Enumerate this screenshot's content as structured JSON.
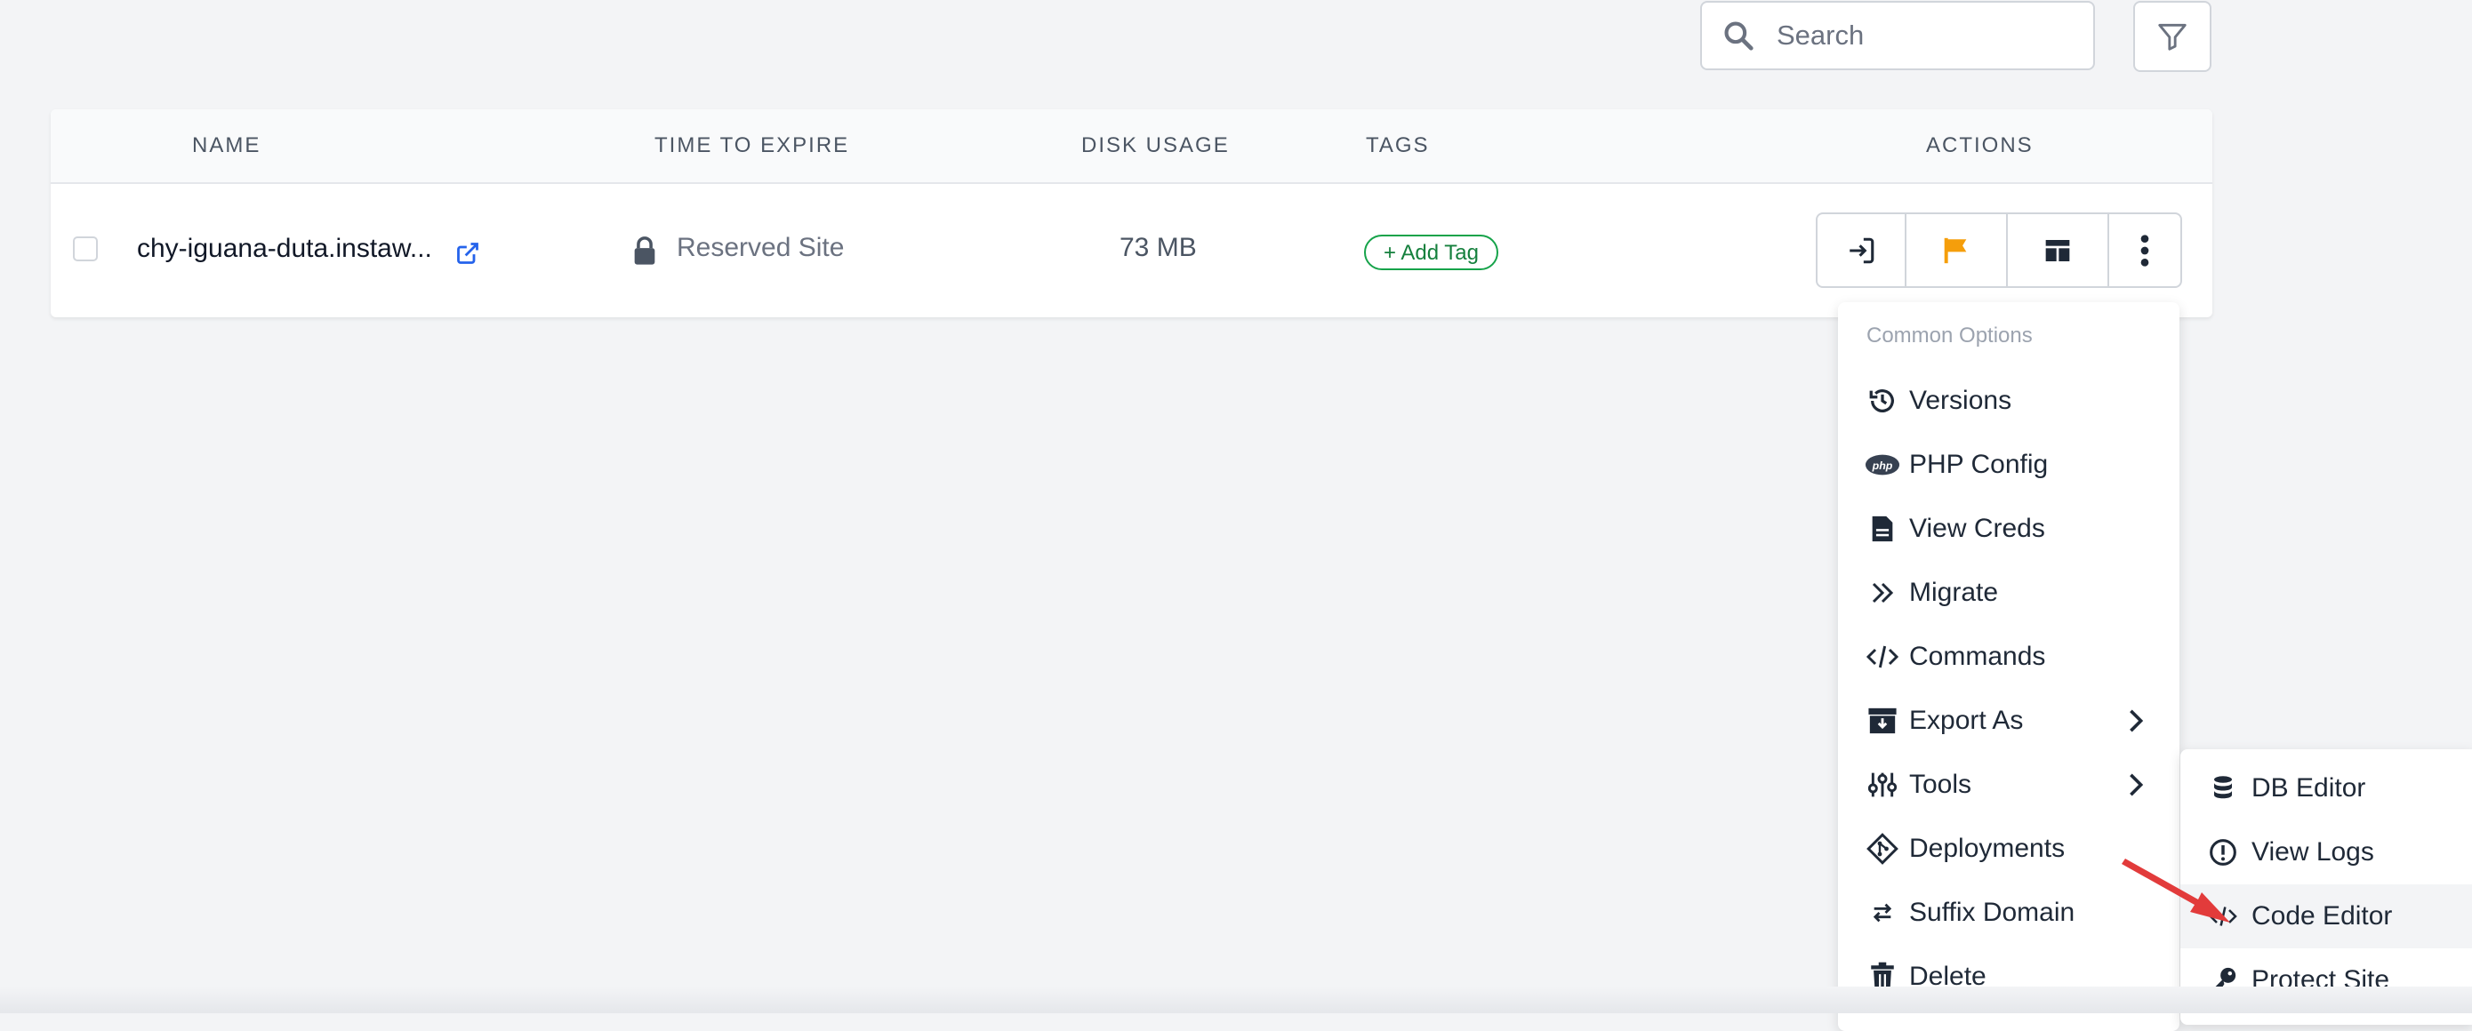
{
  "search": {
    "placeholder": "Search"
  },
  "table": {
    "columns": [
      "NAME",
      "TIME TO EXPIRE",
      "DISK USAGE",
      "TAGS",
      "ACTIONS"
    ],
    "rows": [
      {
        "name": "chy-iguana-duta.instaw...",
        "time_to_expire": "Reserved Site",
        "disk_usage": "73 MB",
        "tag_button": "+ Add Tag"
      }
    ]
  },
  "colors": {
    "accent": "#2563eb",
    "flag": "#f59e0b",
    "tag_green": "#16a34a",
    "arrow": "#e23b3b"
  },
  "menu": {
    "header": "Common Options",
    "items": [
      {
        "label": "Versions",
        "icon": "history-icon"
      },
      {
        "label": "PHP Config",
        "icon": "php-icon"
      },
      {
        "label": "View Creds",
        "icon": "document-icon"
      },
      {
        "label": "Migrate",
        "icon": "double-chevron-right-icon"
      },
      {
        "label": "Commands",
        "icon": "code-icon"
      },
      {
        "label": "Export As",
        "icon": "archive-icon",
        "submenu": true
      },
      {
        "label": "Tools",
        "icon": "sliders-icon",
        "submenu": true
      },
      {
        "label": "Deployments",
        "icon": "git-icon"
      },
      {
        "label": "Suffix Domain",
        "icon": "swap-icon"
      },
      {
        "label": "Delete",
        "icon": "trash-icon"
      }
    ]
  },
  "submenu": {
    "items": [
      {
        "label": "DB Editor",
        "icon": "database-icon"
      },
      {
        "label": "View Logs",
        "icon": "alert-circle-icon"
      },
      {
        "label": "Code Editor",
        "icon": "code-icon"
      },
      {
        "label": "Protect Site",
        "icon": "key-icon"
      }
    ]
  }
}
